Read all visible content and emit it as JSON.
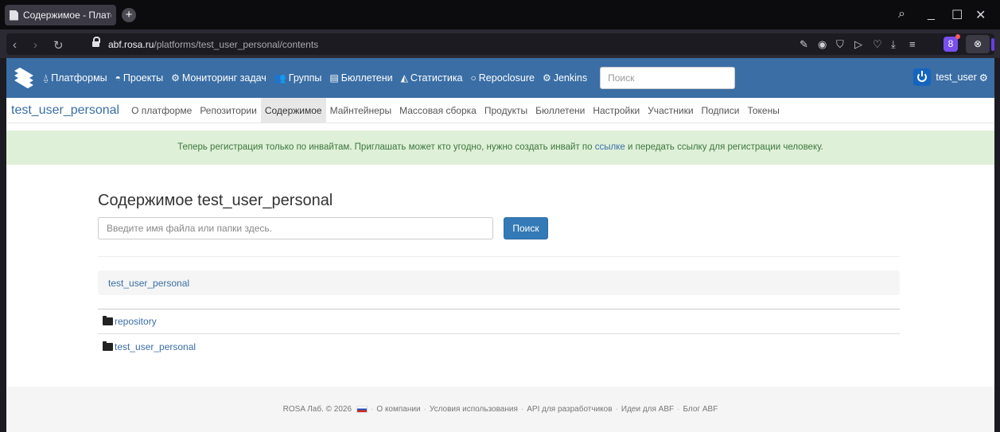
{
  "browser": {
    "tab_title": "Содержимое - Платформ",
    "new_tab": "+",
    "url_host": "abf.rosa.ru",
    "url_path": "/platforms/test_user_personal/contents",
    "profile_letter": "8"
  },
  "navbar": {
    "items": [
      {
        "label": "Платформы",
        "icon": "platform-icon"
      },
      {
        "label": "Проекты",
        "icon": "github-icon"
      },
      {
        "label": "Мониторинг задач",
        "icon": "cogs-icon"
      },
      {
        "label": "Группы",
        "icon": "group-icon"
      },
      {
        "label": "Бюллетени",
        "icon": "list-icon"
      },
      {
        "label": "Статистика",
        "icon": "chart-icon"
      },
      {
        "label": "Repoclosure",
        "icon": "circle-icon"
      },
      {
        "label": "Jenkins",
        "icon": "cogs-icon"
      }
    ],
    "search_placeholder": "Поиск",
    "username": "test_user"
  },
  "subnav": {
    "brand": "test_user_personal",
    "items": [
      {
        "label": "О платформе"
      },
      {
        "label": "Репозитории"
      },
      {
        "label": "Содержимое"
      },
      {
        "label": "Майнтейнеры"
      },
      {
        "label": "Массовая сборка"
      },
      {
        "label": "Продукты"
      },
      {
        "label": "Бюллетени"
      },
      {
        "label": "Настройки"
      },
      {
        "label": "Участники"
      },
      {
        "label": "Подписи"
      },
      {
        "label": "Токены"
      }
    ]
  },
  "notice": {
    "before": "Теперь регистрация только по инвайтам. Приглашать может кто угодно, нужно создать инвайт по ",
    "link": "ссылке",
    "after": " и передать ссылку для регистрации человеку."
  },
  "content": {
    "title": "Содержимое test_user_personal",
    "input_placeholder": "Введите имя файла или папки здесь.",
    "search_button": "Поиск",
    "breadcrumb": "test_user_personal",
    "rows": [
      "repository",
      "test_user_personal"
    ]
  },
  "footer": {
    "copyright": "ROSA Лаб. © 2026",
    "links": [
      "О компании",
      "Условия использования",
      "API для разработчиков",
      "Идеи для ABF",
      "Блог ABF"
    ]
  }
}
